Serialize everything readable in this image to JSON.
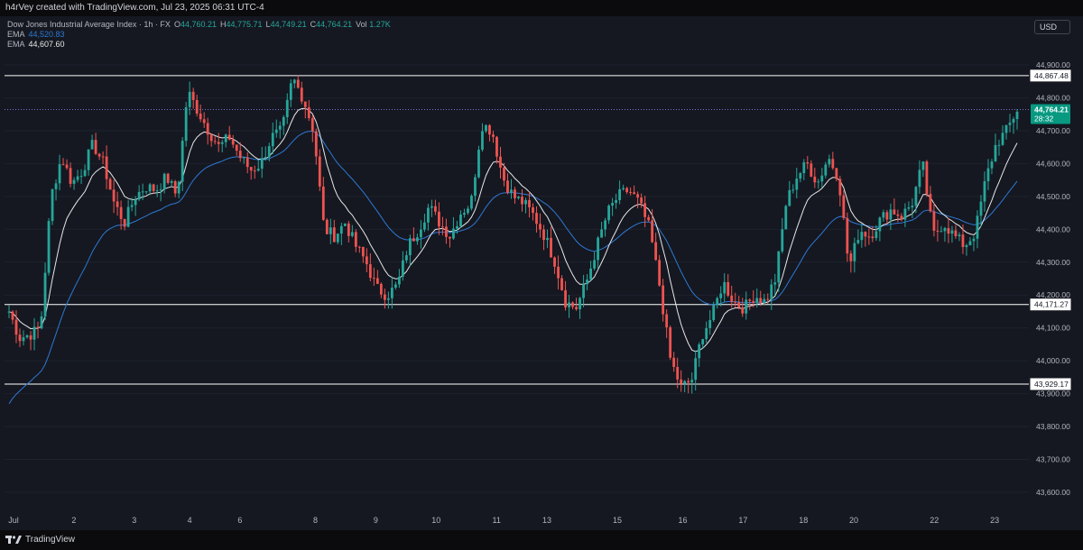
{
  "caption": "h4rVey created with TradingView.com, Jul 23, 2025 06:31 UTC-4",
  "legend": {
    "title": "Dow Jones Industrial Average Index · 1h · FX",
    "o_key": "O",
    "o_val": "44,760.21",
    "h_key": "H",
    "h_val": "44,775.71",
    "l_key": "L",
    "l_val": "44,749.21",
    "c_key": "C",
    "c_val": "44,764.21",
    "vol_key": "Vol",
    "vol_val": "1.27K",
    "ema1_label": "EMA",
    "ema1_val": "44,520.83",
    "ema2_label": "EMA",
    "ema2_val": "44,607.60"
  },
  "currency_button": "USD",
  "footer_brand": "TradingView",
  "colors": {
    "up": "#26a69a",
    "down": "#ef5350",
    "ema_fast": "#e8e8e8",
    "ema_slow": "#2e78d2",
    "price_line": "#7b6fd0",
    "level": "#ffffff",
    "background": "#151821"
  },
  "chart_data": {
    "type": "candlestick",
    "title": "Dow Jones Industrial Average Index · 1h · FX",
    "ylim": [
      43500,
      44950
    ],
    "y_ticks": [
      "44,900.00",
      "44,800.00",
      "44,700.00",
      "44,600.00",
      "44,500.00",
      "44,400.00",
      "44,300.00",
      "44,200.00",
      "44,100.00",
      "44,000.00",
      "43,900.00",
      "43,800.00",
      "43,700.00",
      "43,600.00"
    ],
    "y_tick_values": [
      44900,
      44800,
      44700,
      44600,
      44500,
      44400,
      44300,
      44200,
      44100,
      44000,
      43900,
      43800,
      43700,
      43600
    ],
    "x_ticks": [
      "Jul",
      "2",
      "3",
      "4",
      "6",
      "8",
      "9",
      "10",
      "11",
      "13",
      "15",
      "16",
      "17",
      "18",
      "20",
      "22",
      "23"
    ],
    "x_tick_positions": [
      0.0,
      0.06,
      0.12,
      0.175,
      0.225,
      0.3,
      0.36,
      0.42,
      0.48,
      0.53,
      0.6,
      0.665,
      0.725,
      0.785,
      0.835,
      0.915,
      0.975
    ],
    "horizontal_levels": [
      {
        "value": 44867.48,
        "label": "44,867.48"
      },
      {
        "value": 44171.27,
        "label": "44,171.27"
      },
      {
        "value": 43929.17,
        "label": "43,929.17"
      }
    ],
    "last_price": {
      "value": 44764.21,
      "label": "44,764.21",
      "countdown": "28:32"
    },
    "close_path": [
      44150,
      44070,
      44080,
      44100,
      44500,
      44620,
      44540,
      44580,
      44660,
      44600,
      44480,
      44420,
      44500,
      44530,
      44520,
      44560,
      44500,
      44820,
      44760,
      44700,
      44650,
      44680,
      44620,
      44580,
      44600,
      44680,
      44700,
      44860,
      44800,
      44700,
      44400,
      44380,
      44420,
      44350,
      44300,
      44220,
      44200,
      44230,
      44350,
      44400,
      44470,
      44420,
      44380,
      44450,
      44480,
      44720,
      44700,
      44560,
      44500,
      44480,
      44440,
      44380,
      44300,
      44180,
      44160,
      44240,
      44350,
      44450,
      44500,
      44520,
      44480,
      44400,
      44220,
      44000,
      43920,
      43940,
      44080,
      44140,
      44240,
      44180,
      44160,
      44200,
      44180,
      44250,
      44480,
      44560,
      44600,
      44540,
      44620,
      44560,
      44280,
      44400,
      44380,
      44430,
      44460,
      44440,
      44480,
      44600,
      44380,
      44420,
      44380,
      44350,
      44390,
      44550,
      44660,
      44700,
      44764
    ],
    "ema_fast_last": 44607.6,
    "ema_slow_last": 44520.83
  }
}
